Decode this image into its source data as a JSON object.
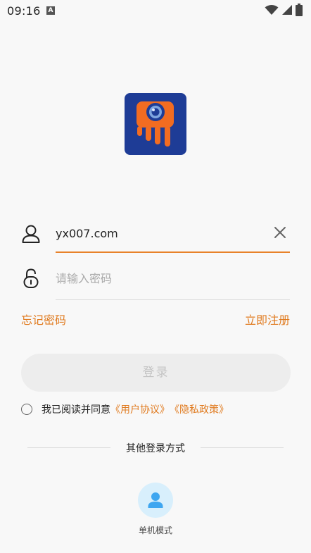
{
  "status_bar": {
    "time": "09:16",
    "notification_letter": "A"
  },
  "login": {
    "username_value": "yx007.com",
    "password_placeholder": "请输入密码",
    "forgot_password": "忘记密码",
    "register": "立即注册",
    "login_button": "登录",
    "agree_prefix": "我已阅读并同意",
    "user_agreement": "《用户协议》",
    "privacy_policy": "《隐私政策》",
    "other_methods": "其他登录方式",
    "single_mode": "单机模式"
  },
  "colors": {
    "accent": "#e07a1e",
    "logo_bg": "#1e3c96",
    "logo_fg": "#f26c21",
    "single_mode_bg": "#d8effc",
    "single_mode_icon": "#3ea6f0"
  },
  "icons": {
    "user": "user-icon",
    "lock": "lock-icon",
    "clear": "close-icon",
    "single_mode": "person-icon"
  }
}
